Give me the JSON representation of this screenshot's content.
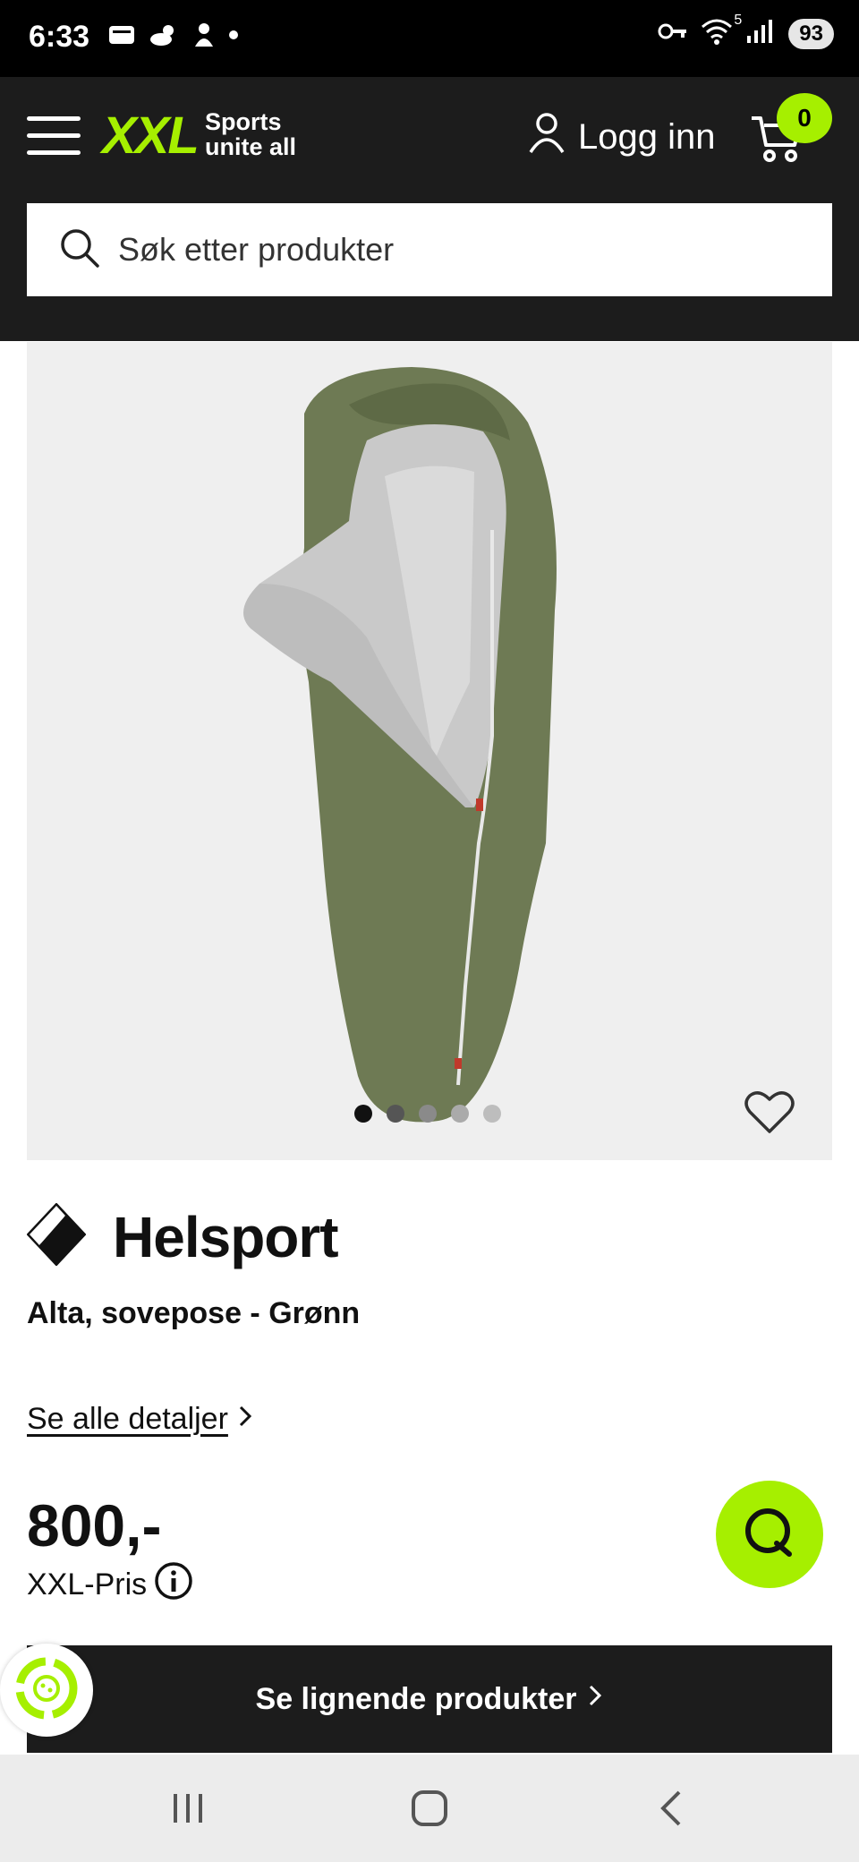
{
  "status_bar": {
    "time": "6:33",
    "network": "5",
    "battery": "93"
  },
  "header": {
    "logo": "XXL",
    "tagline_1": "Sports",
    "tagline_2": "unite all",
    "login_label": "Logg inn",
    "cart_count": "0",
    "accent_color": "#a6ef00"
  },
  "search": {
    "placeholder": "Søk etter produkter"
  },
  "product": {
    "image_dots_total": 5,
    "image_dot_active": 1,
    "brand": "Helsport",
    "title": "Alta, sovepose - Grønn",
    "details_link": "Se alle detaljer",
    "price": "800,-",
    "price_label": "XXL-Pris"
  },
  "actions": {
    "similar_products": "Se lignende produkter"
  },
  "icons": {
    "menu": "hamburger-icon",
    "search": "search-icon",
    "user": "user-icon",
    "cart": "cart-icon",
    "favorite": "heart-icon",
    "chat": "chat-icon",
    "info": "info-icon",
    "chevron": "chevron-right-icon"
  }
}
